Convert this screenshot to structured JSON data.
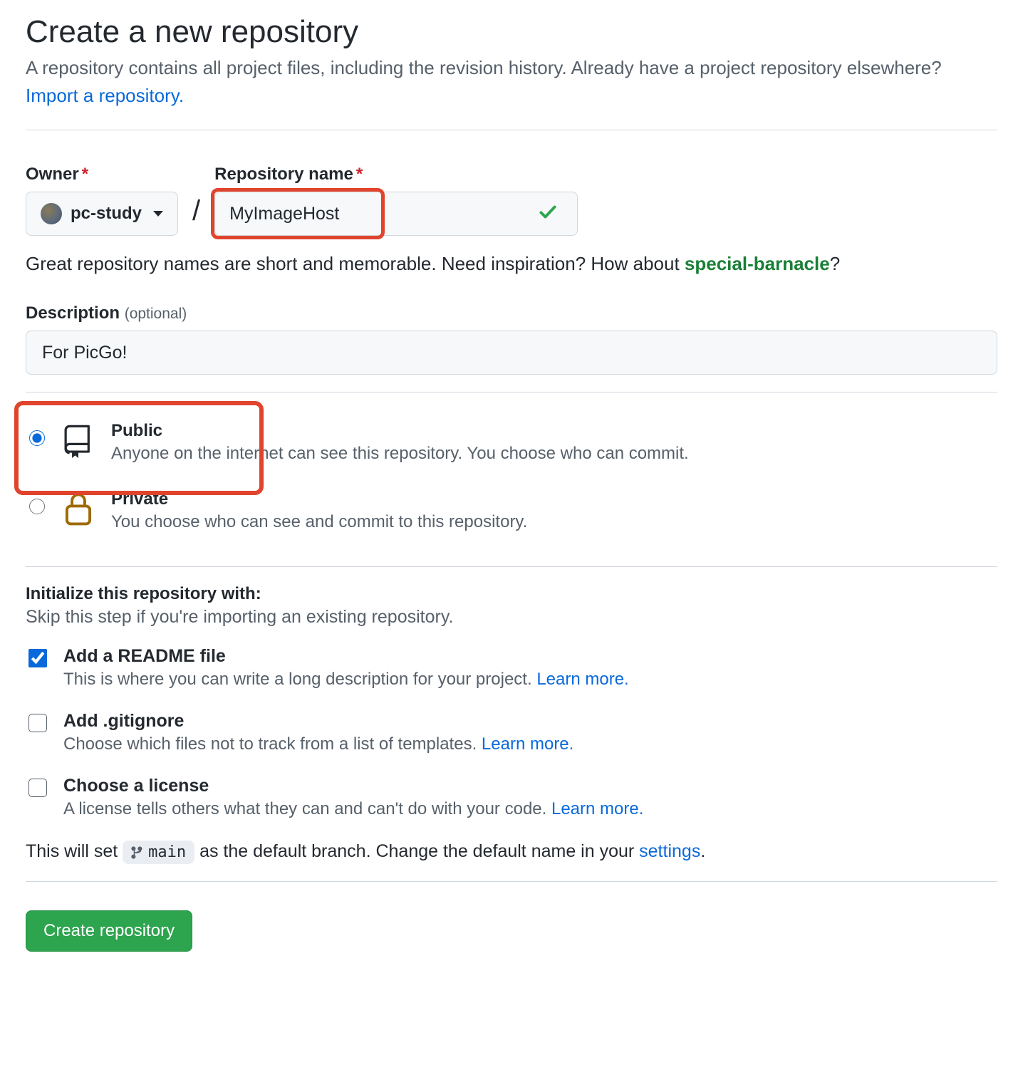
{
  "heading": "Create a new repository",
  "subtitle_prefix": "A repository contains all project files, including the revision history. Already have a project repository elsewhere? ",
  "import_link": "Import a repository.",
  "owner": {
    "label": "Owner",
    "value": "pc-study"
  },
  "repo": {
    "label": "Repository name",
    "value": "MyImageHost"
  },
  "name_helper_prefix": "Great repository names are short and memorable. Need inspiration? How about ",
  "name_suggestion": "special-barnacle",
  "name_helper_suffix": "?",
  "description": {
    "label": "Description",
    "optional": "(optional)",
    "value": "For PicGo!"
  },
  "visibility": {
    "public": {
      "title": "Public",
      "desc": "Anyone on the internet can see this repository. You choose who can commit.",
      "selected": true
    },
    "private": {
      "title": "Private",
      "desc": "You choose who can see and commit to this repository.",
      "selected": false
    }
  },
  "initialize": {
    "title": "Initialize this repository with:",
    "subtitle": "Skip this step if you're importing an existing repository.",
    "readme": {
      "title": "Add a README file",
      "desc": "This is where you can write a long description for your project. ",
      "checked": true
    },
    "gitignore": {
      "title": "Add .gitignore",
      "desc": "Choose which files not to track from a list of templates. ",
      "checked": false
    },
    "license": {
      "title": "Choose a license",
      "desc": "A license tells others what they can and can't do with your code. ",
      "checked": false
    },
    "learn_more": "Learn more."
  },
  "branch": {
    "prefix": "This will set ",
    "name": "main",
    "mid": " as the default branch. Change the default name in your ",
    "settings": "settings",
    "suffix": "."
  },
  "create_button": "Create repository"
}
